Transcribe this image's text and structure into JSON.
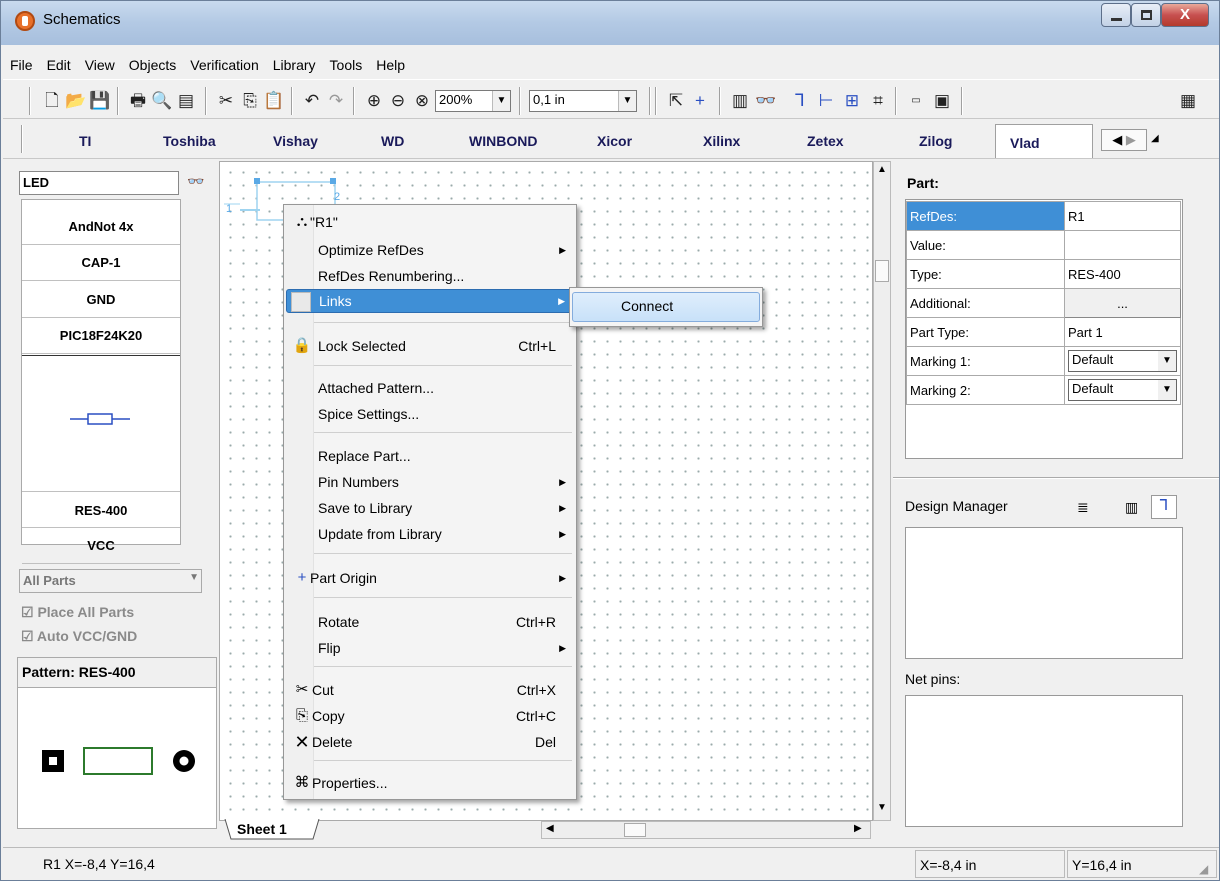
{
  "window": {
    "title": "Schematics",
    "buttons": [
      "minimize",
      "maximize",
      "close"
    ],
    "close_label": "X"
  },
  "menubar": [
    "File",
    "Edit",
    "View",
    "Objects",
    "Verification",
    "Library",
    "Tools",
    "Help"
  ],
  "toolbar": {
    "zoom": "200%",
    "grid": "0,1 in"
  },
  "libraries": {
    "items": [
      "TI",
      "Toshiba",
      "Vishay",
      "WD",
      "WINBOND",
      "Xicor",
      "Xilinx",
      "Zetex",
      "Zilog"
    ],
    "active": "Vlad"
  },
  "left": {
    "search": "LED",
    "parts": [
      "AndNot 4x",
      "CAP-1",
      "GND",
      "PIC18F24K20",
      "RES-400",
      "VCC"
    ],
    "filter": "All Parts",
    "place_all": "Place All Parts",
    "auto_vcc": "Auto VCC/GND",
    "pattern_title": "Pattern: RES-400"
  },
  "canvas": {
    "sheet_tab": "Sheet 1",
    "pin1": "1",
    "pin2": "2"
  },
  "context_menu": {
    "title": "\"R1\"",
    "items": {
      "optimize": "Optimize RefDes",
      "renumber": "RefDes Renumbering...",
      "links": "Links",
      "lock": "Lock Selected",
      "lock_sc": "Ctrl+L",
      "attached": "Attached Pattern...",
      "spice": "Spice Settings...",
      "replace": "Replace Part...",
      "pins": "Pin Numbers",
      "save": "Save to Library",
      "update": "Update from Library",
      "origin": "Part Origin",
      "rotate": "Rotate",
      "rotate_sc": "Ctrl+R",
      "flip": "Flip",
      "cut": "Cut",
      "cut_sc": "Ctrl+X",
      "copy": "Copy",
      "copy_sc": "Ctrl+C",
      "delete": "Delete",
      "delete_sc": "Del",
      "props": "Properties..."
    },
    "submenu_connect": "Connect"
  },
  "right": {
    "part_title": "Part:",
    "props": [
      {
        "k": "RefDes:",
        "v": "R1"
      },
      {
        "k": "Value:",
        "v": ""
      },
      {
        "k": "Type:",
        "v": "RES-400"
      },
      {
        "k": "Additional:",
        "v": "..."
      },
      {
        "k": "Part Type:",
        "v": "Part 1"
      },
      {
        "k": "Marking 1:",
        "v": "Default"
      },
      {
        "k": "Marking 2:",
        "v": "Default"
      }
    ],
    "design_manager": "Design Manager",
    "net_pins": "Net pins:"
  },
  "status": {
    "left": "R1  X=-8,4  Y=16,4",
    "x": "X=-8,4 in",
    "y": "Y=16,4 in"
  }
}
